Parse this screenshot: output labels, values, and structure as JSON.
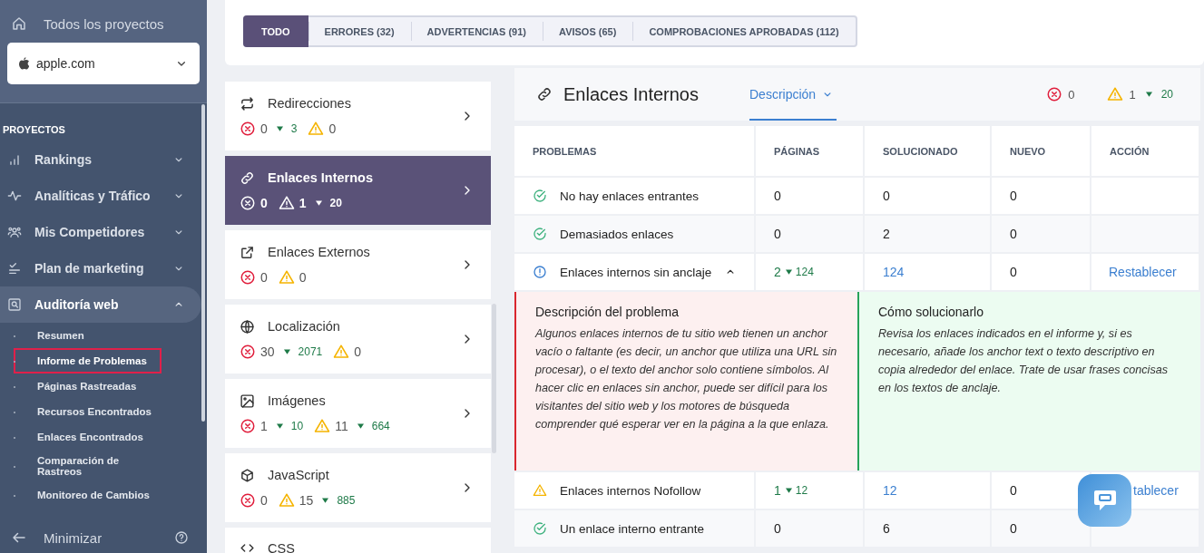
{
  "sidebar": {
    "all_projects": "Todos los proyectos",
    "project": "apple.com",
    "section": "PROYECTOS",
    "items": [
      {
        "label": "Rankings",
        "expanded": false,
        "selected": false
      },
      {
        "label": "Analíticas y Tráfico",
        "expanded": false,
        "selected": false
      },
      {
        "label": "Mis Competidores",
        "expanded": false,
        "selected": false
      },
      {
        "label": "Plan de marketing",
        "expanded": false,
        "selected": false
      },
      {
        "label": "Auditoría web",
        "expanded": true,
        "selected": true,
        "children": [
          {
            "label": "Resumen",
            "selected": false
          },
          {
            "label": "Informe de Problemas",
            "selected": true
          },
          {
            "label": "Páginas Rastreadas",
            "selected": false
          },
          {
            "label": "Recursos Encontrados",
            "selected": false
          },
          {
            "label": "Enlaces Encontrados",
            "selected": false
          },
          {
            "label": "Comparación de Rastreos",
            "selected": false
          },
          {
            "label": "Monitoreo de Cambios",
            "selected": false
          }
        ]
      }
    ],
    "minimize": "Minimizar"
  },
  "tabs": [
    {
      "label": "TODO",
      "selected": true
    },
    {
      "label": "ERRORES (32)",
      "selected": false
    },
    {
      "label": "ADVERTENCIAS (91)",
      "selected": false
    },
    {
      "label": "AVISOS (65)",
      "selected": false
    },
    {
      "label": "COMPROBACIONES APROBADAS (112)",
      "selected": false
    }
  ],
  "categories": [
    {
      "name": "Redirecciones",
      "errors": "0",
      "errors_delta": "3",
      "warnings": "0",
      "selected": false
    },
    {
      "name": "Enlaces Internos",
      "errors": "0",
      "warnings": "1",
      "warnings_delta": "20",
      "selected": true
    },
    {
      "name": "Enlaces Externos",
      "errors": "0",
      "warnings": "0",
      "selected": false
    },
    {
      "name": "Localización",
      "errors": "30",
      "errors_delta": "2071",
      "warnings": "0",
      "selected": false
    },
    {
      "name": "Imágenes",
      "errors": "1",
      "errors_delta": "10",
      "warnings": "11",
      "warnings_delta": "664",
      "selected": false
    },
    {
      "name": "JavaScript",
      "errors": "0",
      "warnings": "15",
      "warnings_delta": "885",
      "selected": false
    },
    {
      "name": "CSS",
      "selected": false
    }
  ],
  "panel": {
    "title": "Enlaces Internos",
    "view": "Descripción",
    "errors": "0",
    "warnings": "1",
    "warnings_delta": "20",
    "columns": [
      "PROBLEMAS",
      "PÁGINAS",
      "SOLUCIONADO",
      "NUEVO",
      "ACCIÓN"
    ],
    "rows": [
      {
        "kind": "passed",
        "problem": "No hay enlaces entrantes",
        "pages": "0",
        "solved": "0",
        "solved_link": false,
        "new": "0"
      },
      {
        "kind": "passed",
        "problem": "Demasiados enlaces",
        "pages": "0",
        "solved": "2",
        "solved_link": false,
        "new": "0"
      },
      {
        "kind": "notice",
        "problem": "Enlaces internos sin anclaje",
        "expanded": true,
        "pages": "2",
        "pages_delta": "124",
        "solved": "124",
        "solved_link": true,
        "new": "0",
        "action": "Restablecer",
        "details": {
          "description_title": "Descripción del problema",
          "description": "Algunos enlaces internos de tu sitio web tienen un anchor vacío o faltante (es decir, un anchor que utiliza una URL sin procesar), o el texto del anchor solo contiene símbolos. Al hacer clic en enlaces sin anchor, puede ser difícil para los visitantes del sitio web y los motores de búsqueda comprender qué esperar ver en la página a la que enlaza.",
          "solution_title": "Cómo solucionarlo",
          "solution": "Revisa los enlaces indicados en el informe y, si es necesario, añade los anchor text o texto descriptivo en copia alrededor del enlace. Trate de usar frases concisas en los textos de anclaje."
        }
      },
      {
        "kind": "warning",
        "problem": "Enlaces internos Nofollow",
        "pages": "1",
        "pages_delta": "12",
        "solved": "12",
        "solved_link": true,
        "new": "0",
        "action": "tablecer"
      },
      {
        "kind": "passed",
        "problem": "Un enlace interno entrante",
        "pages": "0",
        "solved": "6",
        "solved_link": false,
        "new": "0"
      }
    ]
  }
}
